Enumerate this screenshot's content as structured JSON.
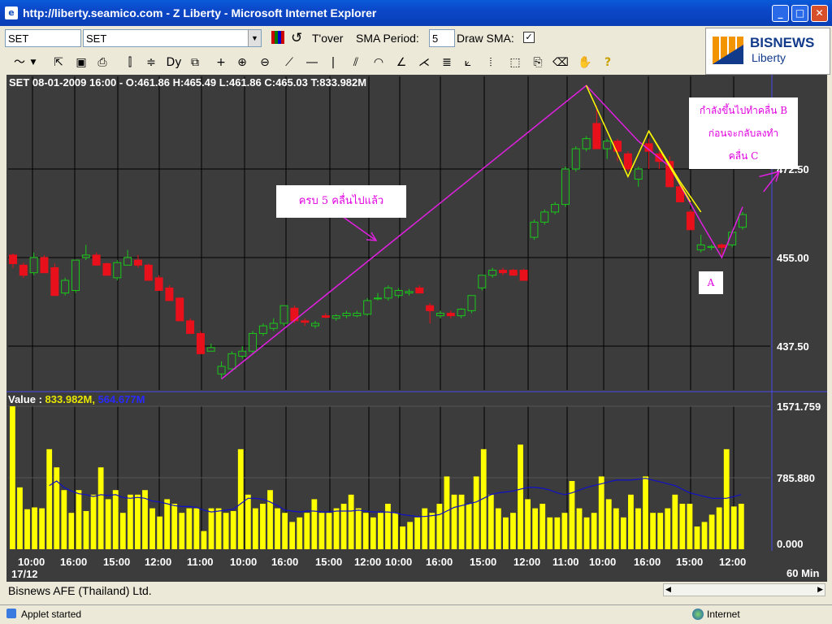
{
  "window": {
    "title": "http://liberty.seamico.com - Z Liberty - Microsoft Internet Explorer",
    "minimize_glyph": "_",
    "maximize_glyph": "□",
    "close_glyph": "✕"
  },
  "toolbar": {
    "symbol_value": "SET",
    "symbol_select_value": "SET",
    "tover_label": "T'over",
    "sma_period_label": "SMA Period:",
    "sma_period_value": "5",
    "draw_sma_label": "Draw SMA:",
    "draw_sma_checked": "✓"
  },
  "logo": {
    "brand": "BISNEWS",
    "product": "Liberty"
  },
  "chart_header": "SET 08-01-2009 16:00 - O:461.86 H:465.49 L:461.86 C:465.03 T:833.982M",
  "volume_header": {
    "prefix": "Value : ",
    "v1": "833.982M,",
    "v2": " 564.677M"
  },
  "annotations": {
    "wave5": "ครบ 5 คลื่นไปแล้ว",
    "waveB_line1": "กำลังขึ้นไปทำคลื่น B",
    "waveB_line2": "ก่อนจะกลับลงทำ",
    "waveB_line3": "คลื่น C",
    "waveA": "A"
  },
  "colors": {
    "background": "#3c3c3c",
    "grid": "#000000",
    "up": "#19c819",
    "down": "#e8101a",
    "volume": "#ffff00",
    "sma": "#1010c8",
    "annotation": "#e020e0",
    "wave_line": "#ffff00"
  },
  "chart_data": [
    {
      "type": "candlestick",
      "y_ticks": [
        "472.50",
        "455.00",
        "437.50"
      ],
      "ylim": [
        425.0,
        490.0
      ],
      "x_tick_labels": [
        "10:00",
        "16:00",
        "15:00",
        "12:00",
        "11:00",
        "10:00",
        "16:00",
        "15:00",
        "12:00",
        "10:00",
        "16:00",
        "15:00",
        "12:00",
        "11:00",
        "10:00",
        "16:00",
        "15:00",
        "12:00"
      ],
      "x_sub_label": "17/12",
      "interval_label": "60 Min",
      "candles": [
        [
          455.5,
          455.8,
          453.0,
          453.8
        ],
        [
          453.5,
          454.0,
          451.0,
          451.5
        ],
        [
          452.0,
          456.0,
          451.5,
          455.0
        ],
        [
          455.0,
          455.5,
          452.0,
          452.0
        ],
        [
          453.0,
          453.8,
          447.5,
          447.5
        ],
        [
          448.0,
          451.0,
          447.5,
          450.5
        ],
        [
          448.5,
          454.5,
          448.0,
          454.5
        ],
        [
          455.0,
          457.5,
          454.5,
          455.5
        ],
        [
          455.5,
          456.0,
          453.5,
          453.5
        ],
        [
          453.8,
          454.0,
          451.5,
          451.5
        ],
        [
          451.0,
          454.5,
          450.5,
          454.0
        ],
        [
          453.5,
          456.5,
          453.5,
          455.0
        ],
        [
          454.5,
          455.5,
          453.0,
          453.5
        ],
        [
          453.5,
          453.8,
          450.5,
          450.5
        ],
        [
          451.0,
          451.5,
          448.5,
          448.5
        ],
        [
          449.0,
          449.5,
          446.5,
          446.5
        ],
        [
          447.0,
          447.0,
          442.5,
          442.5
        ],
        [
          442.5,
          443.0,
          440.0,
          440.0
        ],
        [
          440.0,
          440.5,
          436.0,
          436.0
        ],
        [
          436.5,
          438.0,
          436.5,
          437.2
        ],
        [
          432.0,
          434.5,
          431.0,
          433.5
        ],
        [
          433.0,
          436.5,
          432.5,
          436.0
        ],
        [
          435.5,
          437.5,
          435.0,
          436.5
        ],
        [
          436.5,
          440.5,
          436.0,
          440.0
        ],
        [
          440.0,
          442.0,
          439.5,
          441.5
        ],
        [
          441.0,
          443.0,
          440.5,
          442.0
        ],
        [
          442.0,
          445.5,
          441.5,
          445.5
        ],
        [
          445.0,
          445.5,
          442.0,
          442.5
        ],
        [
          442.5,
          443.0,
          441.5,
          442.2
        ],
        [
          441.5,
          442.5,
          441.0,
          442.0
        ],
        [
          443.5,
          444.0,
          443.0,
          443.2
        ],
        [
          443.0,
          443.8,
          442.5,
          443.5
        ],
        [
          443.5,
          444.5,
          443.0,
          444.0
        ],
        [
          443.5,
          444.5,
          443.2,
          444.0
        ],
        [
          443.8,
          447.0,
          443.5,
          446.5
        ],
        [
          447.0,
          448.0,
          446.5,
          447.0
        ],
        [
          447.0,
          449.5,
          446.5,
          449.0
        ],
        [
          447.5,
          449.0,
          447.0,
          448.5
        ],
        [
          448.0,
          448.8,
          447.5,
          448.3
        ],
        [
          449.0,
          449.5,
          448.0,
          448.0
        ],
        [
          445.5,
          446.0,
          442.0,
          444.5
        ],
        [
          443.5,
          444.5,
          443.0,
          444.0
        ],
        [
          444.0,
          444.5,
          443.0,
          443.5
        ],
        [
          443.5,
          445.0,
          443.0,
          444.8
        ],
        [
          444.5,
          447.5,
          444.0,
          447.5
        ],
        [
          449.0,
          451.5,
          448.5,
          451.5
        ],
        [
          451.5,
          453.0,
          451.0,
          452.5
        ],
        [
          452.5,
          453.0,
          451.5,
          452.0
        ],
        [
          452.5,
          452.8,
          451.5,
          451.5
        ],
        [
          452.5,
          452.8,
          450.5,
          450.5
        ],
        [
          459.0,
          462.5,
          458.5,
          462.0
        ],
        [
          462.0,
          464.5,
          461.5,
          464.0
        ],
        [
          464.0,
          466.0,
          463.5,
          465.5
        ],
        [
          465.5,
          473.0,
          465.0,
          472.5
        ],
        [
          472.5,
          477.0,
          472.0,
          476.5
        ],
        [
          476.5,
          479.0,
          476.0,
          478.5
        ],
        [
          481.5,
          485.0,
          476.5,
          476.5
        ],
        [
          476.5,
          478.5,
          474.5,
          478.0
        ],
        [
          478.0,
          478.5,
          474.0,
          476.0
        ],
        [
          475.5,
          476.0,
          472.0,
          472.5
        ],
        [
          470.5,
          473.0,
          469.0,
          472.5
        ],
        [
          477.5,
          478.5,
          472.5,
          476.0
        ],
        [
          475.5,
          476.0,
          472.5,
          474.0
        ],
        [
          474.0,
          475.0,
          469.0,
          469.0
        ],
        [
          469.0,
          469.5,
          466.0,
          466.0
        ],
        [
          464.0,
          464.5,
          460.5,
          460.5
        ],
        [
          456.5,
          459.5,
          456.0,
          457.5
        ],
        [
          457.0,
          457.5,
          456.5,
          457.2
        ],
        [
          457.5,
          457.8,
          455.5,
          457.0
        ],
        [
          457.5,
          460.5,
          457.0,
          460.0
        ],
        [
          461.0,
          464.0,
          460.5,
          463.5
        ]
      ]
    },
    {
      "type": "bar",
      "y_ticks": [
        "1571.759",
        "785.880",
        "0.000"
      ],
      "ylim": [
        0,
        1571.759
      ],
      "volume": [
        1571,
        680,
        440,
        460,
        450,
        1100,
        900,
        650,
        400,
        650,
        420,
        600,
        900,
        550,
        650,
        400,
        600,
        600,
        650,
        450,
        360,
        550,
        500,
        400,
        450,
        450,
        200,
        450,
        450,
        400,
        420,
        1100,
        600,
        450,
        500,
        650,
        450,
        400,
        300,
        350,
        400,
        550,
        400,
        400,
        450,
        500,
        600,
        450,
        400,
        350,
        400,
        500,
        400,
        250,
        300,
        350,
        450,
        400,
        500,
        800,
        600,
        600,
        500,
        800,
        1100,
        600,
        450,
        350,
        400,
        1150,
        550,
        450,
        500,
        350,
        350,
        400,
        750,
        450,
        350,
        400,
        800,
        550,
        450,
        350,
        600,
        450,
        800,
        400,
        400,
        450,
        600,
        500,
        500,
        250,
        300,
        380,
        460,
        1100,
        470,
        500
      ],
      "sma": [
        null,
        null,
        null,
        null,
        null,
        700,
        750,
        680,
        640,
        610,
        600,
        580,
        600,
        590,
        600,
        570,
        560,
        570,
        560,
        530,
        520,
        500,
        480,
        470,
        470,
        460,
        430,
        410,
        420,
        430,
        440,
        500,
        560,
        560,
        550,
        520,
        480,
        430,
        420,
        410,
        420,
        420,
        410,
        410,
        420,
        420,
        420,
        430,
        420,
        410,
        410,
        410,
        400,
        380,
        370,
        360,
        360,
        370,
        380,
        420,
        460,
        480,
        500,
        520,
        560,
        600,
        620,
        630,
        640,
        660,
        680,
        680,
        670,
        650,
        620,
        600,
        620,
        650,
        680,
        700,
        720,
        740,
        760,
        760,
        760,
        770,
        780,
        760,
        740,
        720,
        700,
        660,
        620,
        600,
        580,
        560,
        560,
        560,
        580,
        600
      ]
    }
  ]
}
